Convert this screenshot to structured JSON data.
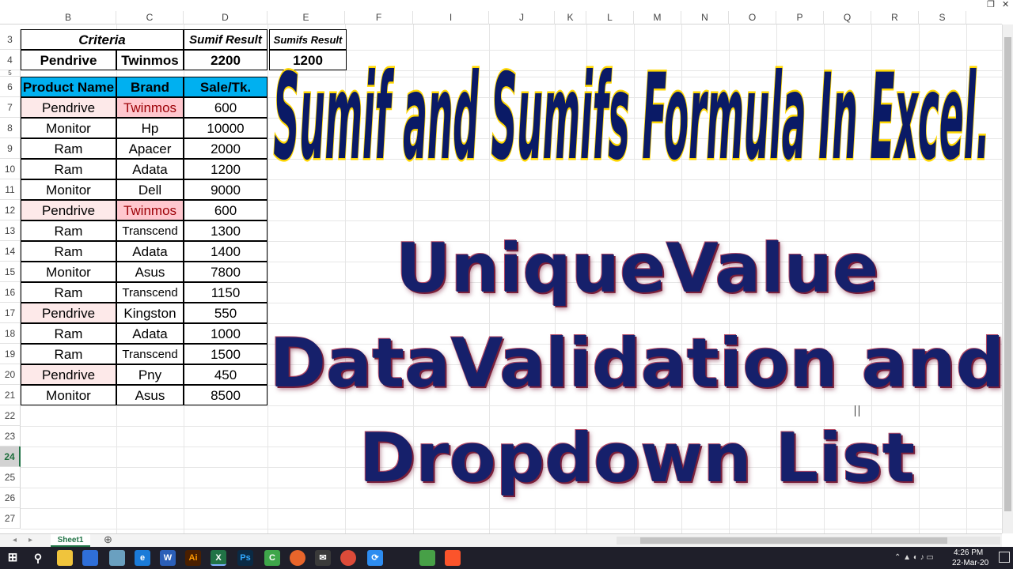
{
  "window": {
    "restore_label": "❐",
    "close_label": "✕"
  },
  "columns": [
    "B",
    "C",
    "D",
    "E",
    "F",
    "I",
    "J",
    "K",
    "L",
    "M",
    "N",
    "O",
    "P",
    "Q",
    "R",
    "S"
  ],
  "rows": [
    "3",
    "4",
    "5",
    "6",
    "7",
    "8",
    "9",
    "10",
    "11",
    "12",
    "13",
    "14",
    "15",
    "16",
    "17",
    "18",
    "19",
    "20",
    "21",
    "22",
    "23",
    "24",
    "25",
    "26",
    "27"
  ],
  "selected_row": "24",
  "criteria_block": {
    "criteria_label": "Criteria",
    "sumif_label": "Sumif Result",
    "sumifs_label": "Sumifs Result",
    "product": "Pendrive",
    "brand": "Twinmos",
    "sumif_value": "2200",
    "sumifs_value": "1200"
  },
  "table": {
    "headers": [
      "Product Name",
      "Brand",
      "Sale/Tk."
    ],
    "rows": [
      {
        "product": "Pendrive",
        "brand": "Twinmos",
        "sale": "600"
      },
      {
        "product": "Monitor",
        "brand": "Hp",
        "sale": "10000"
      },
      {
        "product": "Ram",
        "brand": "Apacer",
        "sale": "2000"
      },
      {
        "product": "Ram",
        "brand": "Adata",
        "sale": "1200"
      },
      {
        "product": "Monitor",
        "brand": "Dell",
        "sale": "9000"
      },
      {
        "product": "Pendrive",
        "brand": "Twinmos",
        "sale": "600"
      },
      {
        "product": "Ram",
        "brand": "Transcend",
        "sale": "1300"
      },
      {
        "product": "Ram",
        "brand": "Adata",
        "sale": "1400"
      },
      {
        "product": "Monitor",
        "brand": "Asus",
        "sale": "7800"
      },
      {
        "product": "Ram",
        "brand": "Transcend",
        "sale": "1150"
      },
      {
        "product": "Pendrive",
        "brand": "Kingston",
        "sale": "550"
      },
      {
        "product": "Ram",
        "brand": "Adata",
        "sale": "1000"
      },
      {
        "product": "Ram",
        "brand": "Transcend",
        "sale": "1500"
      },
      {
        "product": "Pendrive",
        "brand": "Pny",
        "sale": "450"
      },
      {
        "product": "Monitor",
        "brand": "Asus",
        "sale": "8500"
      }
    ]
  },
  "overlay": {
    "title": "Sumif and Sumifs Formula In Excel.",
    "line1": "UniqueValue",
    "line2": "DataValidation and",
    "line3": "Dropdown List"
  },
  "sheet_tab": "Sheet1",
  "add_sheet": "⊕",
  "taskbar": {
    "time": "4:26 PM",
    "date": "22-Mar-20"
  },
  "colors": {
    "header_fill": "#00b0f0",
    "highlight_pink": "#fde9e9",
    "highlight_red_fill": "#ffc7ce",
    "highlight_red_text": "#9c0006",
    "title_fill": "#0a1a66",
    "title_outline": "#ffd700",
    "big_text": "#16206b"
  }
}
